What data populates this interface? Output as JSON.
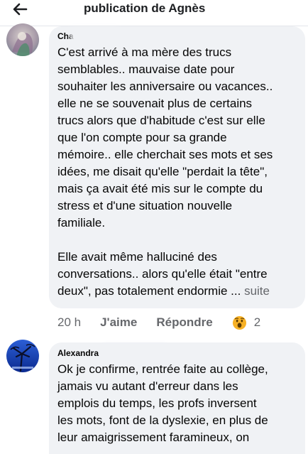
{
  "header": {
    "title": "publication de Agnès",
    "back_icon": "arrow-left-icon"
  },
  "comments": [
    {
      "author": "Cha",
      "text": "C'est arrivé à ma mère des trucs\nsemblables.. mauvaise date pour\nsouhaiter les anniversaire ou vacances..\nelle ne se souvenait plus de certains\ntrucs alors que d'habitude c'est sur elle\nque l'on compte pour sa grande\nmémoire.. elle cherchait ses mots et ses\nidées, me disait qu'elle \"perdait la tête\",\nmais ça avait été mis sur le compte du\nstress et d'une situation nouvelle\nfamiliale.\n\nElle avait même halluciné des\nconversations.. alors qu'elle était \"entre\ndeux\", pas totalement endormie",
      "ellipsis": " ... ",
      "see_more": "suite",
      "time": "20 h",
      "like_label": "J'aime",
      "reply_label": "Répondre",
      "reaction_icon": "wow-face-icon",
      "reaction_count": "2"
    },
    {
      "author": "Alexandra",
      "text": "Ok je confirme, rentrée faite au collège,\njamais vu autant d'erreur dans les\nemplois du temps, les profs inversent\nles mots, font de la dyslexie, en plus de\nleur amaigrissement faramineux, on"
    }
  ],
  "colors": {
    "bubble": "#f0f2f5",
    "text": "#050505",
    "secondary": "#65676b",
    "reaction": "#f7b125"
  }
}
